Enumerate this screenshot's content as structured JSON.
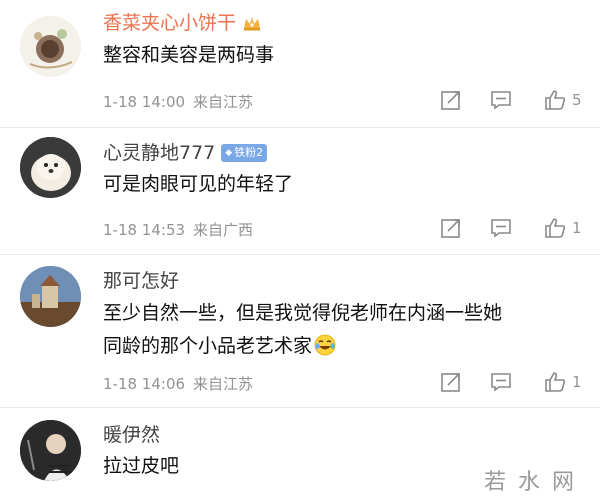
{
  "comments": [
    {
      "username": "香菜夹心小饼干",
      "content": [
        "整容和美容是两码事"
      ],
      "time": "1-18 14:00",
      "location": "来自江苏",
      "likes": "5"
    },
    {
      "username": "心灵静地777",
      "badge": "铁粉2",
      "content": [
        "可是肉眼可见的年轻了"
      ],
      "time": "1-18 14:53",
      "location": "来自广西",
      "likes": "1"
    },
    {
      "username": "那可怎好",
      "content": [
        "至少自然一些，但是我觉得倪老师在内涵一些她",
        "同龄的那个小品老艺术家"
      ],
      "time": "1-18 14:06",
      "location": "来自江苏",
      "likes": "1"
    },
    {
      "username": "暖伊然",
      "content": [
        "拉过皮吧"
      ]
    }
  ],
  "icons": {
    "share": "share-icon",
    "reply": "comment-icon",
    "like": "thumbs-up-icon",
    "vip": "crown-icon",
    "emoji": "laughing-crying-emoji-icon"
  },
  "colors": {
    "vip_username": "#eb7350",
    "meta_gray": "#939393",
    "badge_blue": "#7aa7e6"
  },
  "watermark": "若水网"
}
